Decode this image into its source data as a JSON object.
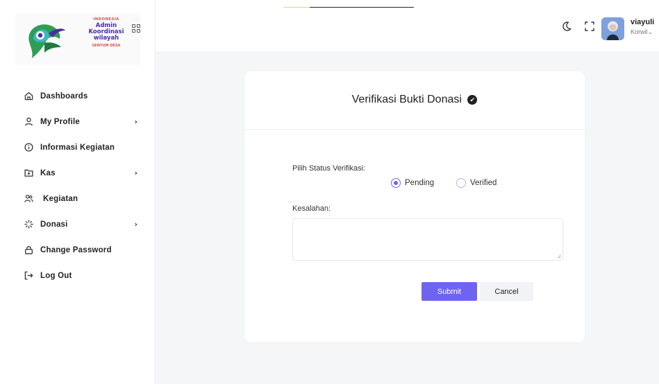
{
  "logo": {
    "top_text": "INDONESIA",
    "main_line1": "Admin",
    "main_line2": "Koordinasi",
    "main_line3": "wilayah",
    "bottom_text": "SENYUM DESA"
  },
  "sidebar": {
    "items": [
      {
        "label": "Dashboards",
        "icon": "home-icon",
        "has_submenu": false
      },
      {
        "label": "My Profile",
        "icon": "user-icon",
        "has_submenu": true
      },
      {
        "label": "Informasi Kegiatan",
        "icon": "info-icon",
        "has_submenu": false
      },
      {
        "label": "Kas",
        "icon": "folder-plus-icon",
        "has_submenu": true
      },
      {
        "label": "Kegiatan",
        "icon": "users-icon",
        "has_submenu": false
      },
      {
        "label": "Donasi",
        "icon": "loader-icon",
        "has_submenu": true
      },
      {
        "label": "Change Password",
        "icon": "lock-icon",
        "has_submenu": false
      },
      {
        "label": "Log Out",
        "icon": "logout-icon",
        "has_submenu": false
      }
    ],
    "chevron": "›"
  },
  "header": {
    "user_name": "viayuli",
    "user_role": "Korwil",
    "role_caret": "⌄"
  },
  "form": {
    "title": "Verifikasi Bukti Donasi",
    "status_label": "Pilih Status Verifikasi:",
    "status_options": [
      {
        "label": "Pending",
        "checked": true
      },
      {
        "label": "Verified",
        "checked": false
      }
    ],
    "error_label": "Kesalahan:",
    "error_value": "",
    "submit_label": "Submit",
    "cancel_label": "Cancel"
  },
  "colors": {
    "accent": "#6f64f2",
    "background": "#f5f6f8"
  }
}
